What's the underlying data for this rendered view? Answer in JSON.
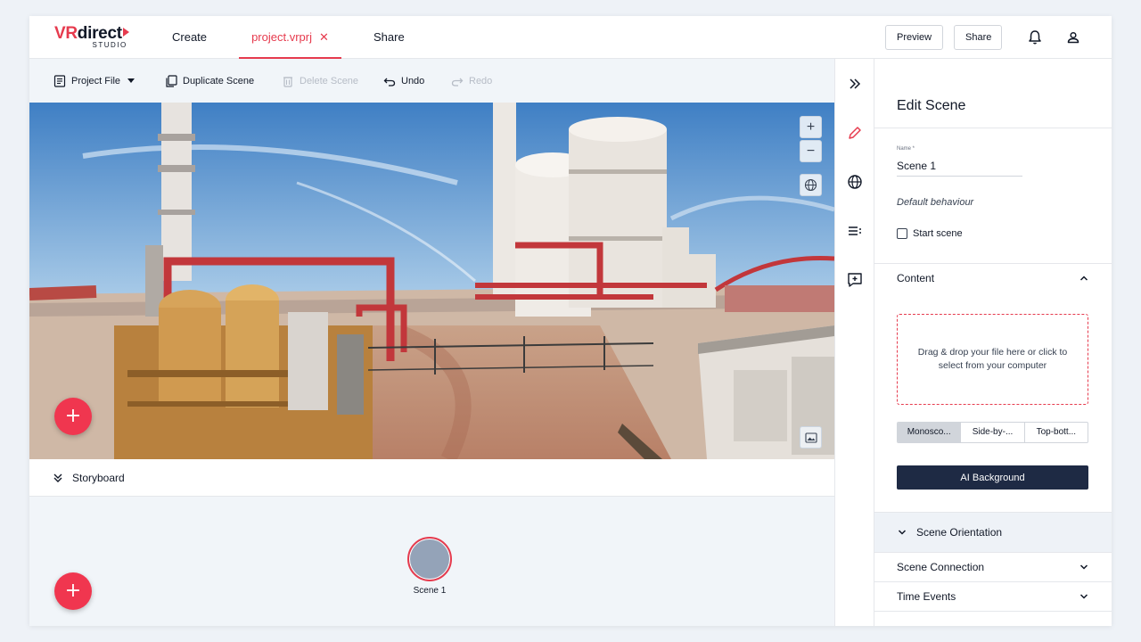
{
  "header": {
    "logo_vr": "VR",
    "logo_direct": "direct",
    "logo_sub": "STUDIO",
    "tabs": [
      {
        "label": "Create"
      },
      {
        "label": "project.vrprj",
        "close": "✕"
      },
      {
        "label": "Share"
      }
    ],
    "preview_label": "Preview",
    "share_label": "Share"
  },
  "toolbar": {
    "project_file": "Project File",
    "duplicate_scene": "Duplicate Scene",
    "delete_scene": "Delete Scene",
    "undo": "Undo",
    "redo": "Redo"
  },
  "viewport": {
    "zoom_in": "+",
    "zoom_out": "−",
    "fab": "+"
  },
  "storyboard": {
    "label": "Storyboard",
    "scene_label": "Scene 1",
    "fab": "+"
  },
  "panel": {
    "title": "Edit Scene",
    "name_label": "Name *",
    "name_value": "Scene 1",
    "default_behaviour": "Default behaviour",
    "start_scene": "Start scene",
    "content_title": "Content",
    "dropzone_text": "Drag & drop your file here or click to select from your computer",
    "stereo_options": [
      "Monosco...",
      "Side-by-...",
      "Top-bott..."
    ],
    "stereo_selected": 0,
    "ai_background": "AI Background",
    "sections": {
      "orientation": "Scene Orientation",
      "connection": "Scene Connection",
      "time_events": "Time Events"
    }
  },
  "colors": {
    "accent": "#e63b4e",
    "dark_button": "#1e2a44",
    "toolbar_bg": "#f1f5f9"
  }
}
